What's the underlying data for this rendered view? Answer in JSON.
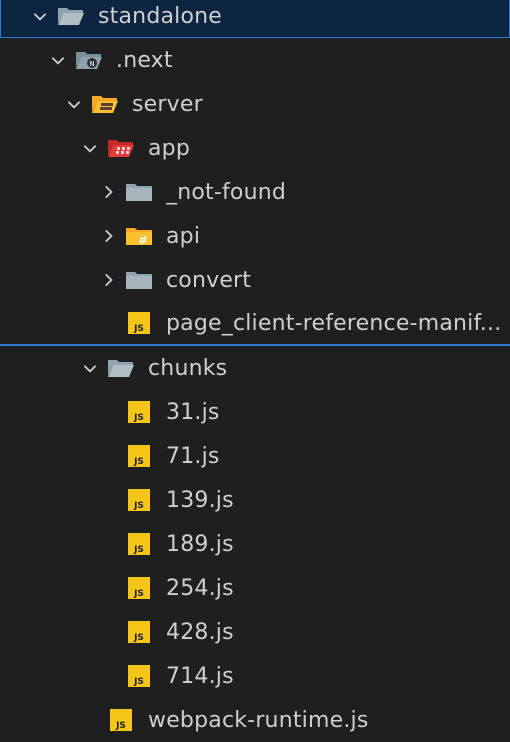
{
  "explorer": {
    "items": [
      {
        "label": "standalone",
        "icon": "folder-open-icon",
        "expanded": true
      },
      {
        "label": ".next",
        "icon": "next-folder-open-icon",
        "expanded": true
      },
      {
        "label": "server",
        "icon": "server-folder-open-icon",
        "expanded": true
      },
      {
        "label": "app",
        "icon": "app-folder-open-icon",
        "expanded": true
      },
      {
        "label": "_not-found",
        "icon": "folder-icon",
        "expanded": false
      },
      {
        "label": "api",
        "icon": "api-folder-icon",
        "expanded": false
      },
      {
        "label": "convert",
        "icon": "folder-icon",
        "expanded": false
      },
      {
        "label": "page_client-reference-manif...",
        "icon": "js-file-icon"
      },
      {
        "label": "chunks",
        "icon": "folder-open-icon",
        "expanded": true
      },
      {
        "label": "31.js",
        "icon": "js-file-icon"
      },
      {
        "label": "71.js",
        "icon": "js-file-icon"
      },
      {
        "label": "139.js",
        "icon": "js-file-icon"
      },
      {
        "label": "189.js",
        "icon": "js-file-icon"
      },
      {
        "label": "254.js",
        "icon": "js-file-icon"
      },
      {
        "label": "428.js",
        "icon": "js-file-icon"
      },
      {
        "label": "714.js",
        "icon": "js-file-icon"
      },
      {
        "label": "webpack-runtime.js",
        "icon": "js-file-icon"
      }
    ]
  },
  "colors": {
    "background": "#1f1f1f",
    "selection": "#0d2540",
    "focus_border": "#2b79d1",
    "folder": "#90a4ae",
    "js_badge": "#f5c518",
    "app_folder": "#e53935",
    "server_folder": "#fbc02d"
  }
}
